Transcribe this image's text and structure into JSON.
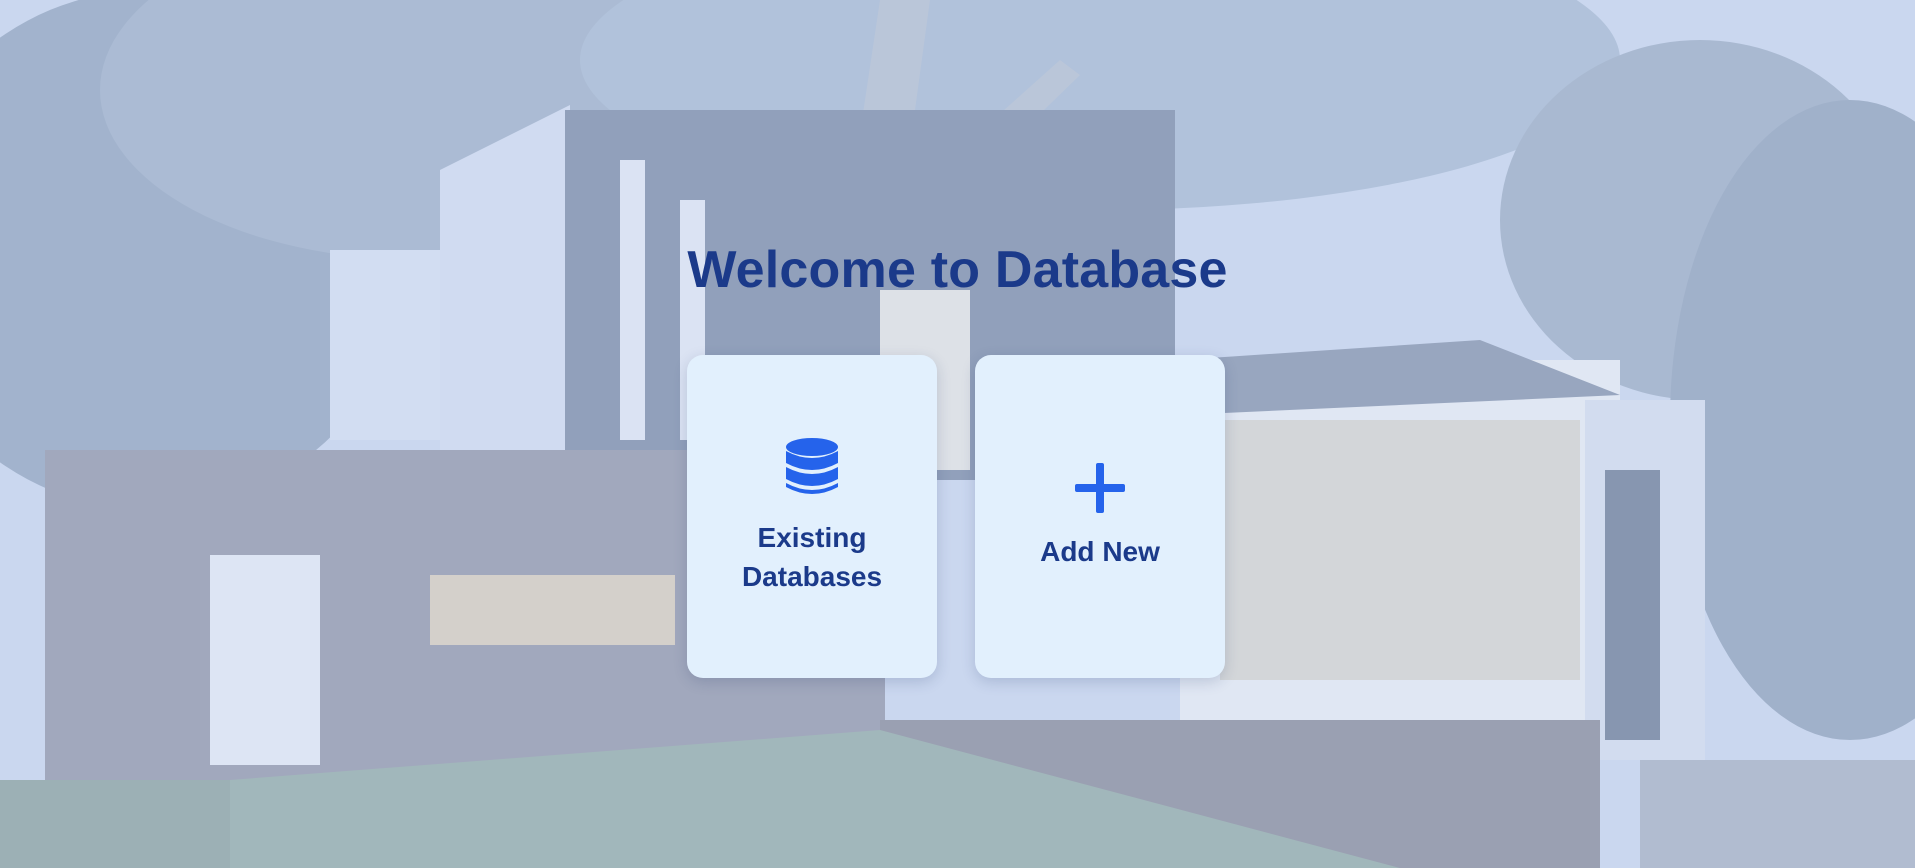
{
  "page": {
    "title": "Welcome to Database"
  },
  "cards": [
    {
      "label": "Existing Databases",
      "icon": "database-icon"
    },
    {
      "label": "Add New",
      "icon": "plus-icon"
    }
  ],
  "colors": {
    "title": "#1b3a8a",
    "card_background": "#e2f0fd",
    "icon_accent": "#2563eb"
  }
}
